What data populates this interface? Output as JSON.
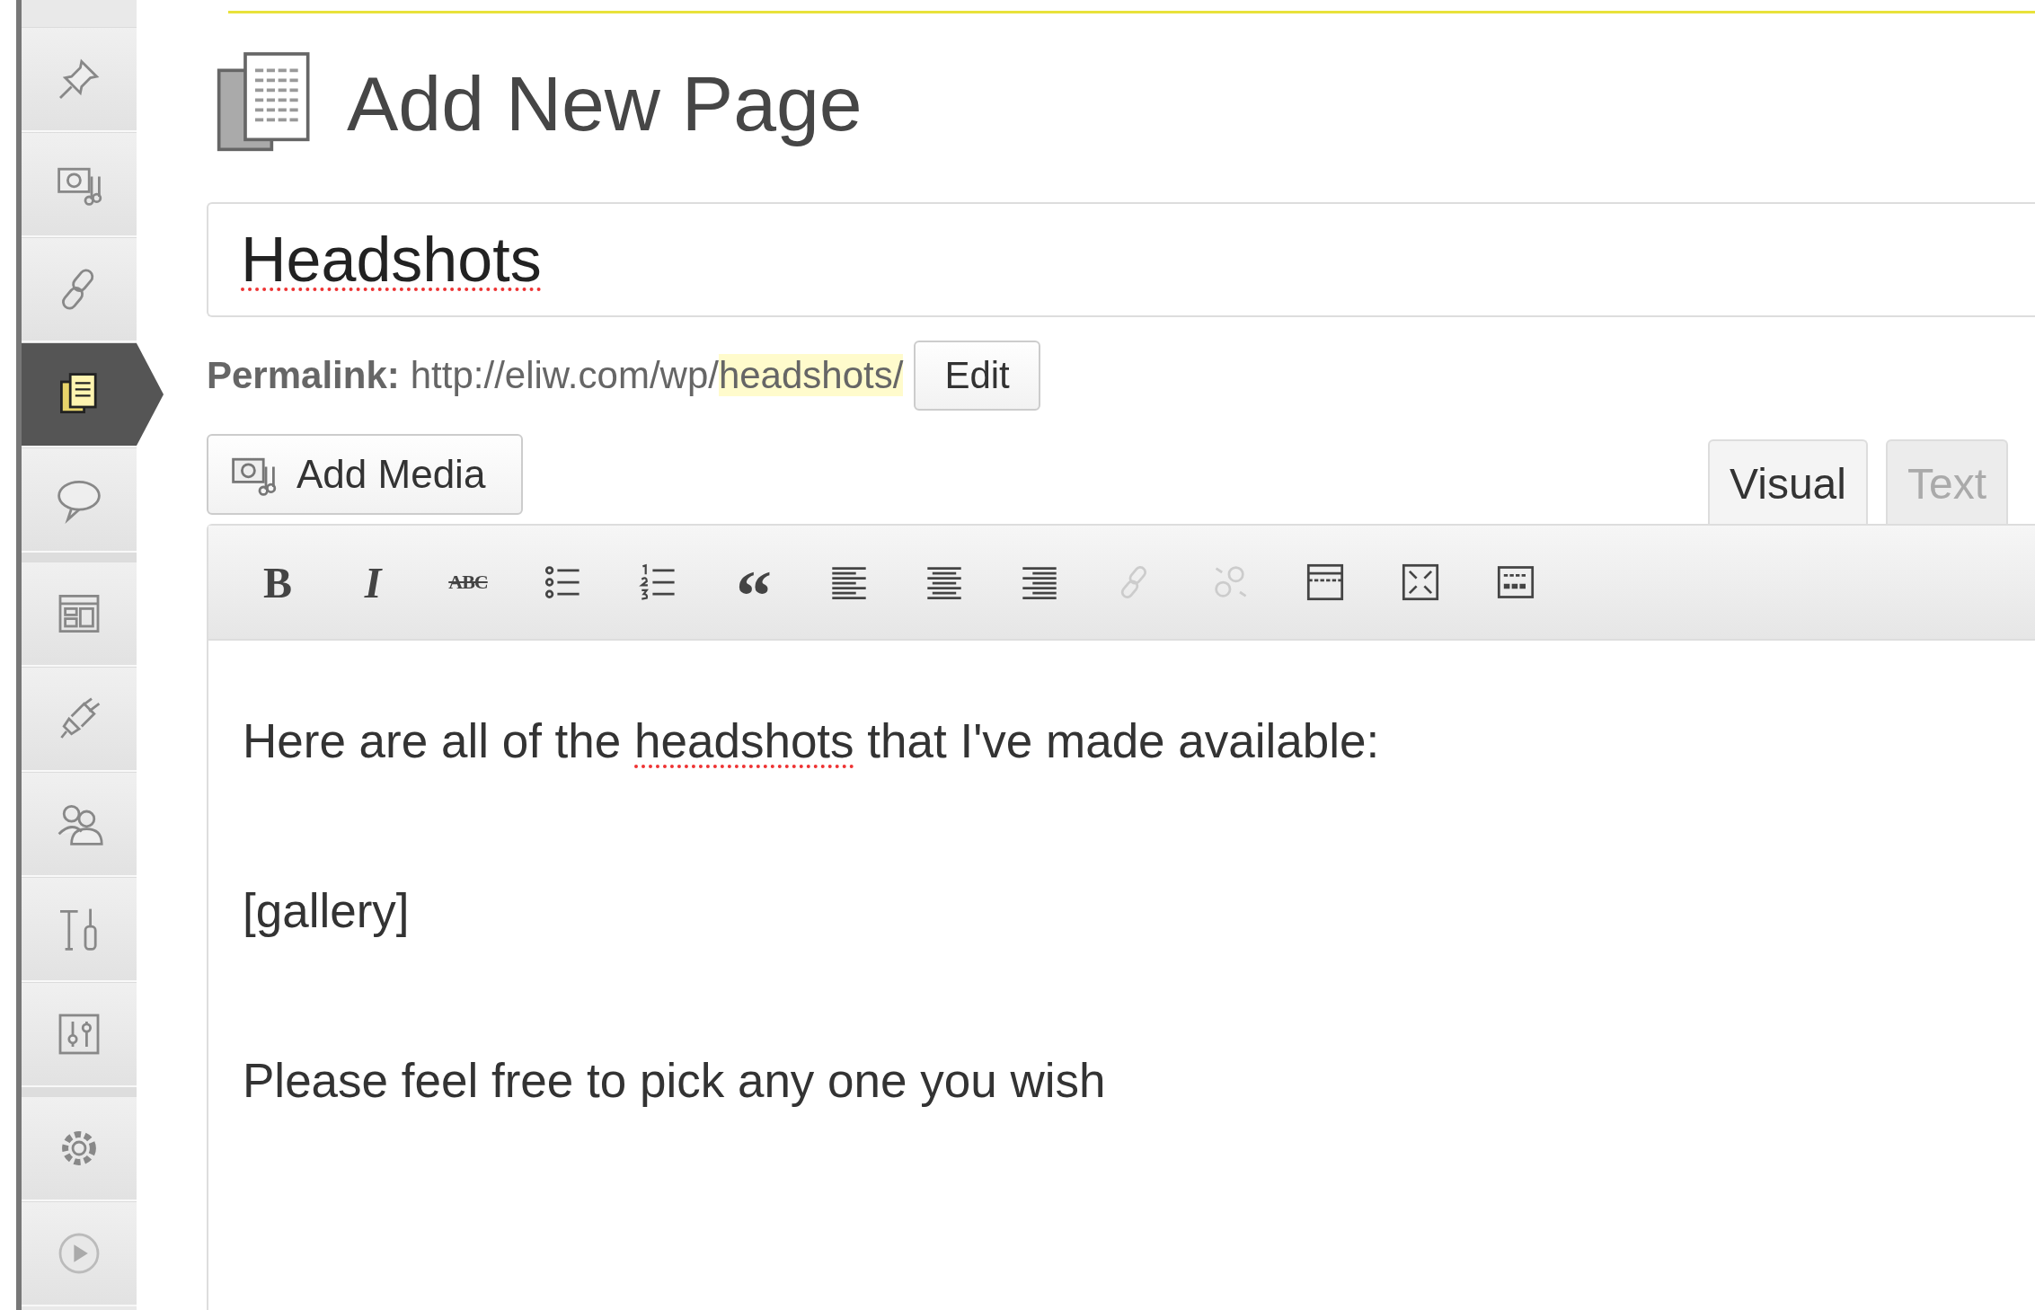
{
  "sidebar": {
    "groups": [
      {
        "items": [
          {
            "kind": "pin",
            "selected": false
          },
          {
            "kind": "media",
            "selected": false
          },
          {
            "kind": "link",
            "selected": false
          },
          {
            "kind": "pages",
            "selected": true
          },
          {
            "kind": "comments",
            "selected": false
          }
        ]
      },
      {
        "items": [
          {
            "kind": "appearance",
            "selected": false
          },
          {
            "kind": "plugins",
            "selected": false
          },
          {
            "kind": "users",
            "selected": false
          },
          {
            "kind": "tools",
            "selected": false
          },
          {
            "kind": "settings",
            "selected": false
          }
        ]
      },
      {
        "items": [
          {
            "kind": "gear",
            "selected": false
          },
          {
            "kind": "collapse",
            "selected": false
          }
        ]
      }
    ]
  },
  "header": {
    "title": "Add New Page"
  },
  "title_field": {
    "value": "Headshots",
    "misspelled": true
  },
  "permalink": {
    "label": "Permalink:",
    "url_base": "http://eliw.com/wp/",
    "slug": "headshots/",
    "edit_button": "Edit"
  },
  "add_media_button": "Add Media",
  "editor_tabs": [
    {
      "label": "Visual",
      "selected": true
    },
    {
      "label": "Text",
      "selected": false
    }
  ],
  "toolbar": [
    {
      "kind": "bold",
      "label": "B",
      "disabled": false
    },
    {
      "kind": "italic",
      "label": "I",
      "disabled": false
    },
    {
      "kind": "strike",
      "label": "ABC",
      "disabled": false
    },
    {
      "kind": "bullets",
      "disabled": false
    },
    {
      "kind": "numbers",
      "disabled": false
    },
    {
      "kind": "quote",
      "label": "“",
      "disabled": false
    },
    {
      "kind": "align-left",
      "disabled": false
    },
    {
      "kind": "align-center",
      "disabled": false
    },
    {
      "kind": "align-right",
      "disabled": false
    },
    {
      "kind": "link",
      "disabled": true
    },
    {
      "kind": "unlink",
      "disabled": true
    },
    {
      "kind": "more",
      "disabled": false
    },
    {
      "kind": "fullscreen",
      "disabled": false
    },
    {
      "kind": "kitchen-sink",
      "disabled": false
    }
  ],
  "content": [
    [
      {
        "text": "Here are all of the ",
        "misspelled": false
      },
      {
        "text": "headshots",
        "misspelled": true
      },
      {
        "text": " that I've made available:",
        "misspelled": false
      }
    ],
    [
      {
        "text": "[gallery]",
        "misspelled": false
      }
    ],
    [
      {
        "text": "Please feel free to pick any one you wish",
        "misspelled": false
      }
    ]
  ]
}
